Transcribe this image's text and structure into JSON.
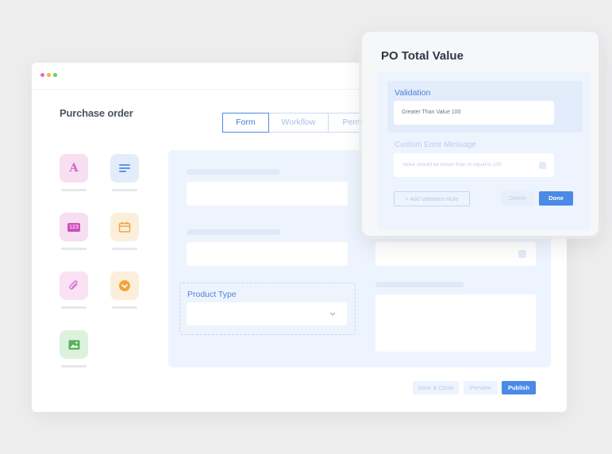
{
  "window": {
    "dots": [
      "#e469c4",
      "#f4b73b",
      "#5fcf66"
    ],
    "title": "Purchase order",
    "tabs": [
      {
        "label": "Form",
        "active": true
      },
      {
        "label": "Workflow",
        "active": false
      },
      {
        "label": "Perm",
        "active": false
      }
    ]
  },
  "palette": [
    {
      "name": "text-field",
      "icon": "letter-a-icon",
      "glyph": "A",
      "color": "#d563c6"
    },
    {
      "name": "multiline-field",
      "icon": "text-lines-icon",
      "glyph": "",
      "color": "#4a8be6"
    },
    {
      "name": "number-field",
      "icon": "number-123-icon",
      "glyph": "123",
      "color": "#cf4fbf"
    },
    {
      "name": "date-field",
      "icon": "calendar-icon",
      "glyph": "",
      "color": "#f0a53c"
    },
    {
      "name": "attachment-field",
      "icon": "paperclip-icon",
      "glyph": "",
      "color": "#de74cf"
    },
    {
      "name": "dropdown-field",
      "icon": "dropdown-circle-icon",
      "glyph": "",
      "color": "#f2a43a"
    },
    {
      "name": "image-field",
      "icon": "image-icon",
      "glyph": "",
      "color": "#5ab25f"
    }
  ],
  "form": {
    "product_type_label": "Product Type"
  },
  "footer": {
    "save_close": "Save & Close",
    "preview": "Preview",
    "publish": "Publish"
  },
  "popup": {
    "title": "PO Total Value",
    "validation_label": "Validation",
    "validation_value": "Greater Than Value 100",
    "error_label": "Custom Error Message",
    "error_value": "Value should be lesser than or equal to 100",
    "add_rule": "+ Add Validation Rule",
    "delete": "Delete",
    "done": "Done"
  },
  "colors": {
    "accent": "#4b8ae6",
    "canvas": "#eef4fd"
  }
}
